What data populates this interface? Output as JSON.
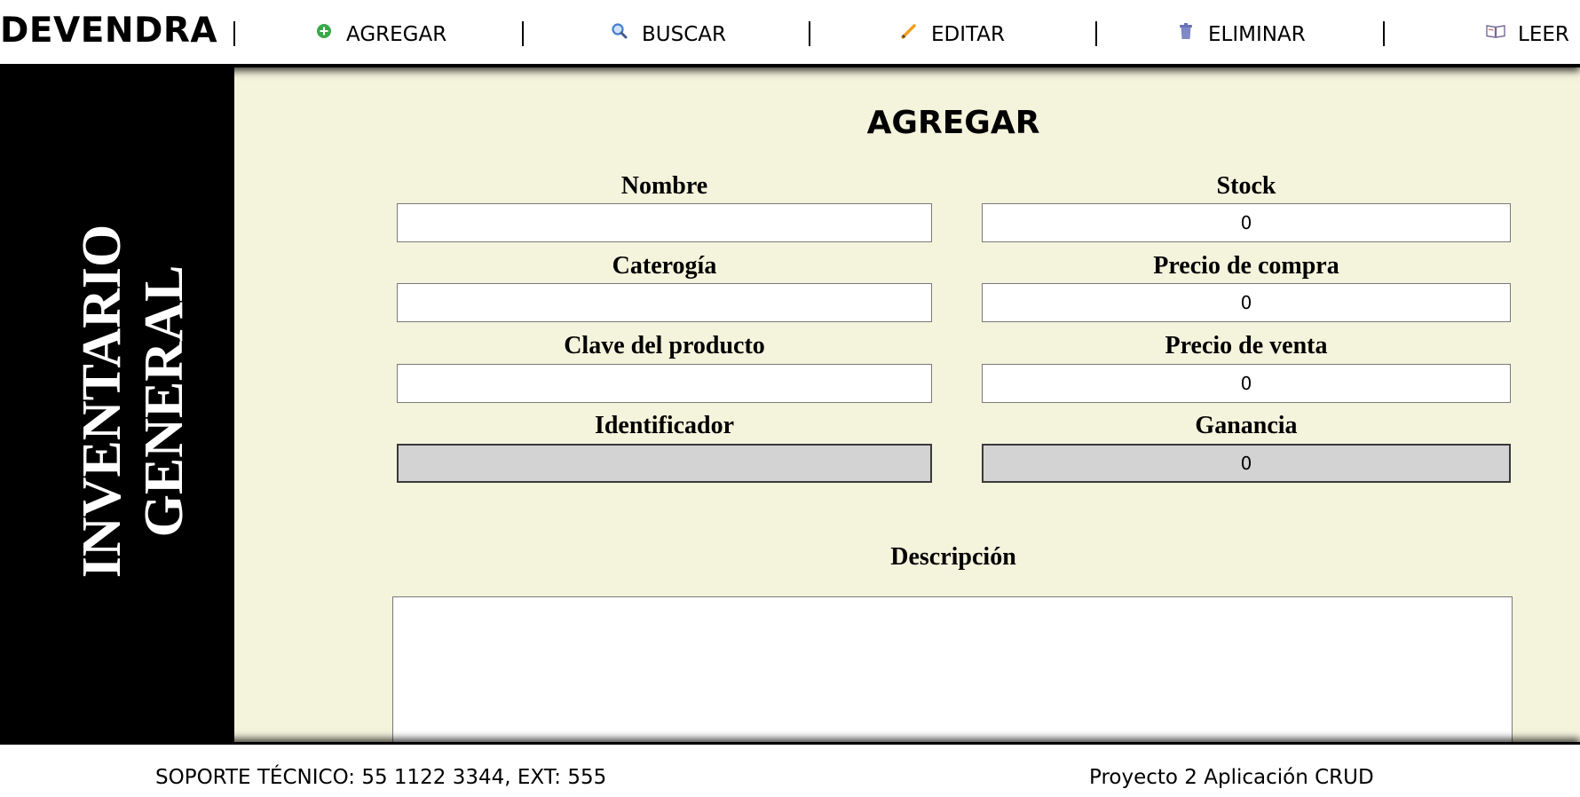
{
  "brand": "DEVENDRA",
  "nav": [
    {
      "label": "AGREGAR",
      "icon": "plus-circle-icon"
    },
    {
      "label": "BUSCAR",
      "icon": "magnifier-icon"
    },
    {
      "label": "EDITAR",
      "icon": "pencil-icon"
    },
    {
      "label": "ELIMINAR",
      "icon": "trash-icon"
    },
    {
      "label": "LEER",
      "icon": "book-icon"
    }
  ],
  "colors": {
    "sidebar": "#000000",
    "main_background": "#f4f3dc",
    "readonly_field": "#d3d3d3",
    "add_icon": "#3aa84a",
    "search_icon": "#3f7fd0",
    "edit_icon": "#f0a020",
    "delete_icon": "#8088c8"
  },
  "sidebar": {
    "title_line1": "INVENTARIO",
    "title_line2": "GENERAL"
  },
  "form": {
    "title": "AGREGAR",
    "fields": {
      "nombre": {
        "label": "Nombre",
        "value": ""
      },
      "categoria": {
        "label": "Caterogía",
        "value": ""
      },
      "clave": {
        "label": "Clave del producto",
        "value": ""
      },
      "identificador": {
        "label": "Identificador",
        "value": ""
      },
      "stock": {
        "label": "Stock",
        "value": "0"
      },
      "precio_compra": {
        "label": "Precio de compra",
        "value": "0"
      },
      "precio_venta": {
        "label": "Precio de venta",
        "value": "0"
      },
      "ganancia": {
        "label": "Ganancia",
        "value": "0"
      }
    },
    "description_label": "Descripción",
    "description_value": ""
  },
  "footer": {
    "support": "SOPORTE TÉCNICO: 55 1122 3344, EXT: 555",
    "project": "Proyecto 2 Aplicación CRUD"
  }
}
